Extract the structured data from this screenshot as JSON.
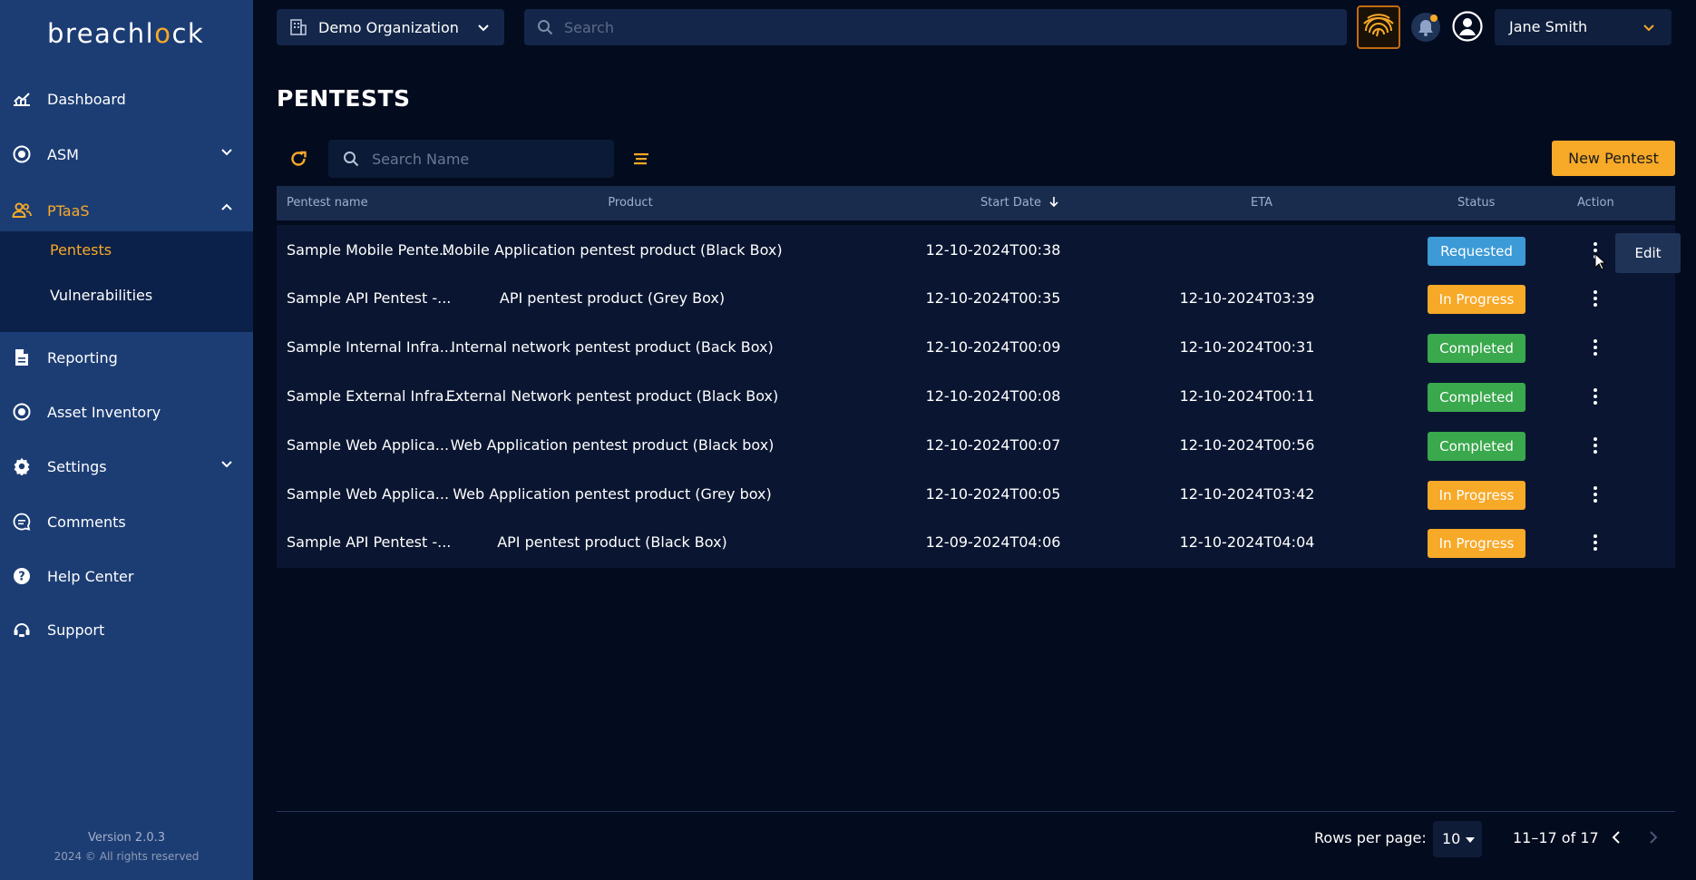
{
  "brand": {
    "logo_left": "breachl",
    "logo_o": "o",
    "logo_right": "ck",
    "accent": "#f7a928",
    "sidebar_bg": "#1c3d74"
  },
  "topbar": {
    "organization": "Demo Organization",
    "search_placeholder": "Search",
    "user_name": "Jane Smith"
  },
  "sidebar": {
    "items": [
      {
        "label": "Dashboard",
        "icon": "chart-line-icon"
      },
      {
        "label": "ASM",
        "icon": "target-icon"
      },
      {
        "label": "PTaaS",
        "icon": "users-icon"
      },
      {
        "label": "Reporting",
        "icon": "document-icon"
      },
      {
        "label": "Asset Inventory",
        "icon": "target-icon"
      },
      {
        "label": "Settings",
        "icon": "gear-icon"
      },
      {
        "label": "Comments",
        "icon": "comment-icon"
      },
      {
        "label": "Help Center",
        "icon": "help-icon"
      },
      {
        "label": "Support",
        "icon": "support-icon"
      }
    ],
    "sub_items": [
      {
        "label": "Pentests"
      },
      {
        "label": "Vulnerabilities"
      }
    ],
    "version": "Version 2.0.3",
    "copyright": "2024 © All rights reserved"
  },
  "main": {
    "title": "PENTESTS",
    "name_search_placeholder": "Search Name",
    "new_button": "New Pentest",
    "columns": [
      "Pentest name",
      "Product",
      "Start Date",
      "ETA",
      "Status",
      "Action"
    ],
    "rows": [
      {
        "name": "Sample Mobile Pente...",
        "product": "Mobile Application pentest product (Black Box)",
        "start": "12-10-2024T00:38",
        "eta": "",
        "status": "Requested"
      },
      {
        "name": "Sample API Pentest -...",
        "product": "API pentest product (Grey Box)",
        "start": "12-10-2024T00:35",
        "eta": "12-10-2024T03:39",
        "status": "In Progress"
      },
      {
        "name": "Sample Internal Infra...",
        "product": "Internal network pentest product (Back Box)",
        "start": "12-10-2024T00:09",
        "eta": "12-10-2024T00:31",
        "status": "Completed"
      },
      {
        "name": "Sample External Infra...",
        "product": "External Network pentest product (Black Box)",
        "start": "12-10-2024T00:08",
        "eta": "12-10-2024T00:11",
        "status": "Completed"
      },
      {
        "name": "Sample Web Applica...",
        "product": "Web Application pentest product (Black box)",
        "start": "12-10-2024T00:07",
        "eta": "12-10-2024T00:56",
        "status": "Completed"
      },
      {
        "name": "Sample Web Applica...",
        "product": "Web Application pentest product (Grey box)",
        "start": "12-10-2024T00:05",
        "eta": "12-10-2024T03:42",
        "status": "In Progress"
      },
      {
        "name": "Sample API Pentest -...",
        "product": "API pentest product (Black Box)",
        "start": "12-09-2024T04:06",
        "eta": "12-10-2024T04:04",
        "status": "In Progress"
      }
    ],
    "status_colors": {
      "Requested": "#3c9ad6",
      "In Progress": "#f7a928",
      "Completed": "#3aa84d"
    },
    "edit_popup": "Edit"
  },
  "pagination": {
    "rows_per_page_label": "Rows per page:",
    "rows_per_page": "10",
    "range": "11–17 of 17"
  }
}
